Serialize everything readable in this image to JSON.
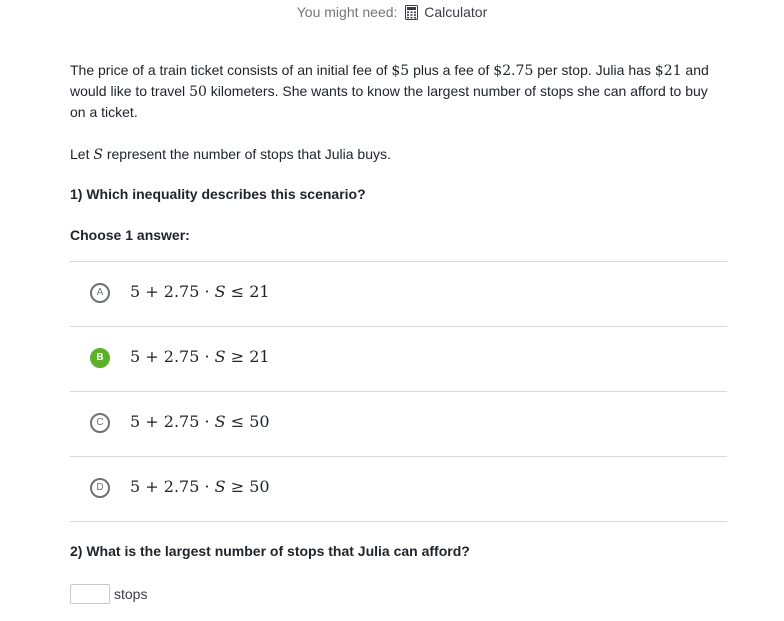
{
  "toolbar": {
    "prompt": "You might need:",
    "tool_label": "Calculator",
    "tool_icon": "calculator-icon"
  },
  "problem": {
    "intro_part1": "The price of a train ticket consists of an initial fee of ",
    "fee_initial": "$5",
    "intro_part2": " plus a fee of ",
    "fee_stop": "$2.75",
    "intro_part3": " per stop. Julia has ",
    "budget": "$21",
    "intro_part4": " and would like to travel ",
    "distance": "50",
    "intro_part5": " kilometers. She wants to know the largest number of stops she can afford to buy on a ticket.",
    "let_prefix": "Let ",
    "variable": "S",
    "let_suffix": " represent the number of stops that Julia buys."
  },
  "question1": {
    "title": "1) Which inequality describes this scenario?",
    "instruction": "Choose 1 answer:",
    "choices": [
      {
        "letter": "A",
        "expr_left": "5 + 2.75 · ",
        "var": "S",
        "expr_right": " ≤ 21",
        "selected": false
      },
      {
        "letter": "B",
        "expr_left": "5 + 2.75 · ",
        "var": "S",
        "expr_right": " ≥ 21",
        "selected": true
      },
      {
        "letter": "C",
        "expr_left": "5 + 2.75 · ",
        "var": "S",
        "expr_right": " ≤ 50",
        "selected": false
      },
      {
        "letter": "D",
        "expr_left": "5 + 2.75 · ",
        "var": "S",
        "expr_right": " ≥ 50",
        "selected": false
      }
    ]
  },
  "question2": {
    "title": "2) What is the largest number of stops that Julia can afford?",
    "answer_value": "",
    "unit": "stops"
  },
  "colors": {
    "selected": "#5cb02a",
    "bubble_border": "#6f7177",
    "divider": "#d6d8da"
  }
}
